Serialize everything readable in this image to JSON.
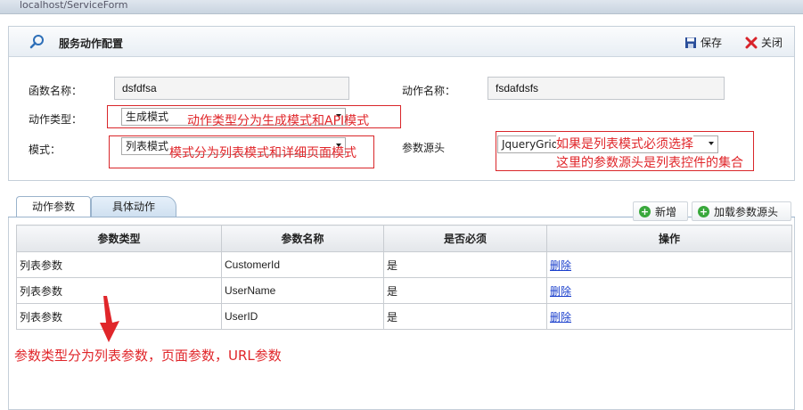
{
  "window": {
    "title": "localhost/ServiceForm"
  },
  "header": {
    "title": "服务动作配置",
    "save_label": "保存",
    "close_label": "关闭"
  },
  "form": {
    "func_name_label": "函数名称：",
    "func_name_value": "dsfdfsa",
    "action_name_label": "动作名称：",
    "action_name_value": "fsdafdsfs",
    "action_type_label": "动作类型：",
    "action_type_value": "生成模式",
    "mode_label": "模式：",
    "mode_value": "列表模式",
    "param_source_label": "参数源头",
    "param_source_value": "JqueryGrid0"
  },
  "annotations": {
    "action_type_note": "动作类型分为生成模式和API模式",
    "mode_note": "模式分为列表模式和详细页面模式",
    "source_note_1": "如果是列表模式必须选择",
    "source_note_2": "这里的参数源头是列表控件的集合",
    "param_type_note": "参数类型分为列表参数，页面参数，URL参数"
  },
  "tabs": [
    {
      "label": "动作参数",
      "active": true
    },
    {
      "label": "具体动作",
      "active": false
    }
  ],
  "toolbar": {
    "add_label": "新增",
    "load_label": "加载参数源头"
  },
  "table": {
    "headers": [
      "参数类型",
      "参数名称",
      "是否必须",
      "操作"
    ],
    "rows": [
      {
        "type": "列表参数",
        "name": "CustomerId",
        "required": "是",
        "action": "删除"
      },
      {
        "type": "列表参数",
        "name": "UserName",
        "required": "是",
        "action": "删除"
      },
      {
        "type": "列表参数",
        "name": "UserID",
        "required": "是",
        "action": "删除"
      }
    ]
  },
  "colors": {
    "annotation_red": "#e0262a",
    "link_blue": "#1a3fcc",
    "add_green": "#39a83c"
  }
}
